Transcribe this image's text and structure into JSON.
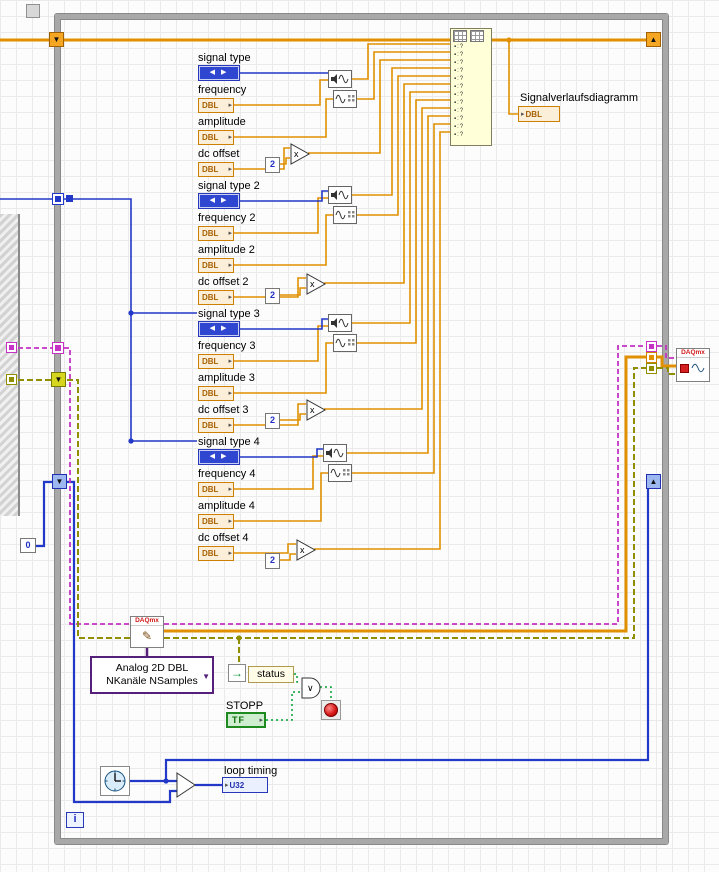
{
  "glyphs": {
    "enum_arrows": "◀ ▶",
    "sr_down": "▼",
    "sr_up": "▲",
    "multiply": "x",
    "or_symbol": "∨",
    "status_arrow": "→",
    "dropdown_arrow": "▼",
    "pencil": "✎",
    "terminal_arrow": "▸"
  },
  "groups": [
    {
      "signal_type_label": "signal type",
      "frequency_label": "frequency",
      "amplitude_label": "amplitude",
      "dc_offset_label": "dc offset",
      "multiplier_constant": "2",
      "numeric_type": "DBL"
    },
    {
      "signal_type_label": "signal type 2",
      "frequency_label": "frequency 2",
      "amplitude_label": "amplitude 2",
      "dc_offset_label": "dc offset 2",
      "multiplier_constant": "2",
      "numeric_type": "DBL"
    },
    {
      "signal_type_label": "signal type 3",
      "frequency_label": "frequency 3",
      "amplitude_label": "amplitude 3",
      "dc_offset_label": "dc offset 3",
      "multiplier_constant": "2",
      "numeric_type": "DBL"
    },
    {
      "signal_type_label": "signal type 4",
      "frequency_label": "frequency 4",
      "amplitude_label": "amplitude 4",
      "dc_offset_label": "dc offset 4",
      "multiplier_constant": "2",
      "numeric_type": "DBL"
    }
  ],
  "merge_node": {
    "rows": 12
  },
  "chart": {
    "label": "Signalverlaufsdiagramm",
    "terminal_type": "DBL"
  },
  "daq_read": {
    "icon_label": "DAQmx",
    "selector_line1": "Analog 2D DBL",
    "selector_line2": "NKanäle NSamples"
  },
  "daq_write": {
    "icon_label": "DAQmx"
  },
  "status_indicator": {
    "label": "status"
  },
  "stop_control": {
    "label": "STOPP",
    "terminal_text": "TF"
  },
  "loop_timing": {
    "label": "loop timing",
    "terminal_type": "U32"
  },
  "init_constant": "0",
  "loop": {
    "iteration_symbol": "i"
  },
  "colors": {
    "orange_wire": "#E09000",
    "blue_wire": "#2238C8",
    "task_wire": "#C431C4",
    "error_wire": "#8F8F00",
    "boolean_wire": "#00A030",
    "loop_border": "#A8A8A8"
  }
}
